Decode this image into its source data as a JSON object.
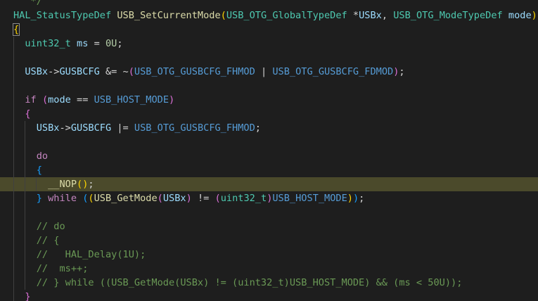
{
  "editor": {
    "theme": "dark",
    "colors": {
      "background": "#1e1e1e",
      "current_line_highlight": "#4b4a2b",
      "type": "#4ec9b0",
      "function": "#dcdcaa",
      "variable": "#9cdcfe",
      "macro": "#569cd6",
      "control_keyword": "#c586c0",
      "number": "#b5cea8",
      "comment": "#6a9955"
    },
    "lines": [
      {
        "tokens": [
          {
            "t": "   */",
            "c": "cmt"
          }
        ]
      },
      {
        "tokens": [
          {
            "t": "HAL_StatusTypeDef",
            "c": "type"
          },
          {
            "t": " ",
            "c": ""
          },
          {
            "t": "USB_SetCurrentMode",
            "c": "fn"
          },
          {
            "t": "(",
            "c": "p1"
          },
          {
            "t": "USB_OTG_GlobalTypeDef",
            "c": "type"
          },
          {
            "t": " *",
            "c": ""
          },
          {
            "t": "USBx",
            "c": "param"
          },
          {
            "t": ", ",
            "c": ""
          },
          {
            "t": "USB_OTG_ModeTypeDef",
            "c": "type"
          },
          {
            "t": " ",
            "c": ""
          },
          {
            "t": "mode",
            "c": "param"
          },
          {
            "t": ")",
            "c": "p1"
          }
        ]
      },
      {
        "tokens": [
          {
            "t": "{",
            "c": "p1 brace-box"
          }
        ]
      },
      {
        "tokens": [
          {
            "t": "  ",
            "c": ""
          },
          {
            "t": "uint32_t",
            "c": "type"
          },
          {
            "t": " ",
            "c": ""
          },
          {
            "t": "ms",
            "c": "param"
          },
          {
            "t": " = ",
            "c": ""
          },
          {
            "t": "0U",
            "c": "num"
          },
          {
            "t": ";",
            "c": ""
          }
        ]
      },
      {
        "tokens": []
      },
      {
        "tokens": [
          {
            "t": "  ",
            "c": ""
          },
          {
            "t": "USBx",
            "c": "param"
          },
          {
            "t": "->",
            "c": ""
          },
          {
            "t": "GUSBCFG",
            "c": "param"
          },
          {
            "t": " &= ~",
            "c": ""
          },
          {
            "t": "(",
            "c": "p2"
          },
          {
            "t": "USB_OTG_GUSBCFG_FHMOD",
            "c": "macro"
          },
          {
            "t": " | ",
            "c": ""
          },
          {
            "t": "USB_OTG_GUSBCFG_FDMOD",
            "c": "macro"
          },
          {
            "t": ")",
            "c": "p2"
          },
          {
            "t": ";",
            "c": ""
          }
        ]
      },
      {
        "tokens": []
      },
      {
        "tokens": [
          {
            "t": "  ",
            "c": ""
          },
          {
            "t": "if",
            "c": "ctrl"
          },
          {
            "t": " ",
            "c": ""
          },
          {
            "t": "(",
            "c": "p2"
          },
          {
            "t": "mode",
            "c": "param"
          },
          {
            "t": " == ",
            "c": ""
          },
          {
            "t": "USB_HOST_MODE",
            "c": "macro"
          },
          {
            "t": ")",
            "c": "p2"
          }
        ]
      },
      {
        "tokens": [
          {
            "t": "  ",
            "c": ""
          },
          {
            "t": "{",
            "c": "p2"
          }
        ]
      },
      {
        "tokens": [
          {
            "t": "    ",
            "c": ""
          },
          {
            "t": "USBx",
            "c": "param"
          },
          {
            "t": "->",
            "c": ""
          },
          {
            "t": "GUSBCFG",
            "c": "param"
          },
          {
            "t": " |= ",
            "c": ""
          },
          {
            "t": "USB_OTG_GUSBCFG_FHMOD",
            "c": "macro"
          },
          {
            "t": ";",
            "c": ""
          }
        ]
      },
      {
        "tokens": []
      },
      {
        "tokens": [
          {
            "t": "    ",
            "c": ""
          },
          {
            "t": "do",
            "c": "ctrl"
          }
        ]
      },
      {
        "tokens": [
          {
            "t": "    ",
            "c": ""
          },
          {
            "t": "{",
            "c": "p3"
          }
        ]
      },
      {
        "tokens": [
          {
            "t": "      ",
            "c": ""
          },
          {
            "t": "__NOP",
            "c": "fn"
          },
          {
            "t": "(",
            "c": "p1"
          },
          {
            "t": ")",
            "c": "p1"
          },
          {
            "t": ";",
            "c": ""
          }
        ],
        "highlight": true
      },
      {
        "tokens": [
          {
            "t": "    ",
            "c": ""
          },
          {
            "t": "}",
            "c": "p3"
          },
          {
            "t": " ",
            "c": ""
          },
          {
            "t": "while",
            "c": "ctrl"
          },
          {
            "t": " ",
            "c": ""
          },
          {
            "t": "(",
            "c": "p3"
          },
          {
            "t": "(",
            "c": "p1"
          },
          {
            "t": "USB_GetMode",
            "c": "fn"
          },
          {
            "t": "(",
            "c": "p2"
          },
          {
            "t": "USBx",
            "c": "param"
          },
          {
            "t": ")",
            "c": "p2"
          },
          {
            "t": " != ",
            "c": ""
          },
          {
            "t": "(",
            "c": "p2"
          },
          {
            "t": "uint32_t",
            "c": "type"
          },
          {
            "t": ")",
            "c": "p2"
          },
          {
            "t": "USB_HOST_MODE",
            "c": "macro"
          },
          {
            "t": ")",
            "c": "p1"
          },
          {
            "t": ")",
            "c": "p3"
          },
          {
            "t": ";",
            "c": ""
          }
        ]
      },
      {
        "tokens": []
      },
      {
        "tokens": [
          {
            "t": "    ",
            "c": ""
          },
          {
            "t": "// do",
            "c": "cmt"
          }
        ]
      },
      {
        "tokens": [
          {
            "t": "    ",
            "c": ""
          },
          {
            "t": "// {",
            "c": "cmt"
          }
        ]
      },
      {
        "tokens": [
          {
            "t": "    ",
            "c": ""
          },
          {
            "t": "//   HAL_Delay(1U);",
            "c": "cmt"
          }
        ]
      },
      {
        "tokens": [
          {
            "t": "    ",
            "c": ""
          },
          {
            "t": "//  ms++;",
            "c": "cmt"
          }
        ]
      },
      {
        "tokens": [
          {
            "t": "    ",
            "c": ""
          },
          {
            "t": "// } while ((USB_GetMode(USBx) != (uint32_t)USB_HOST_MODE) && (ms < 50U));",
            "c": "cmt"
          }
        ]
      },
      {
        "tokens": [
          {
            "t": "  ",
            "c": ""
          },
          {
            "t": "}",
            "c": "p2"
          }
        ]
      }
    ]
  }
}
